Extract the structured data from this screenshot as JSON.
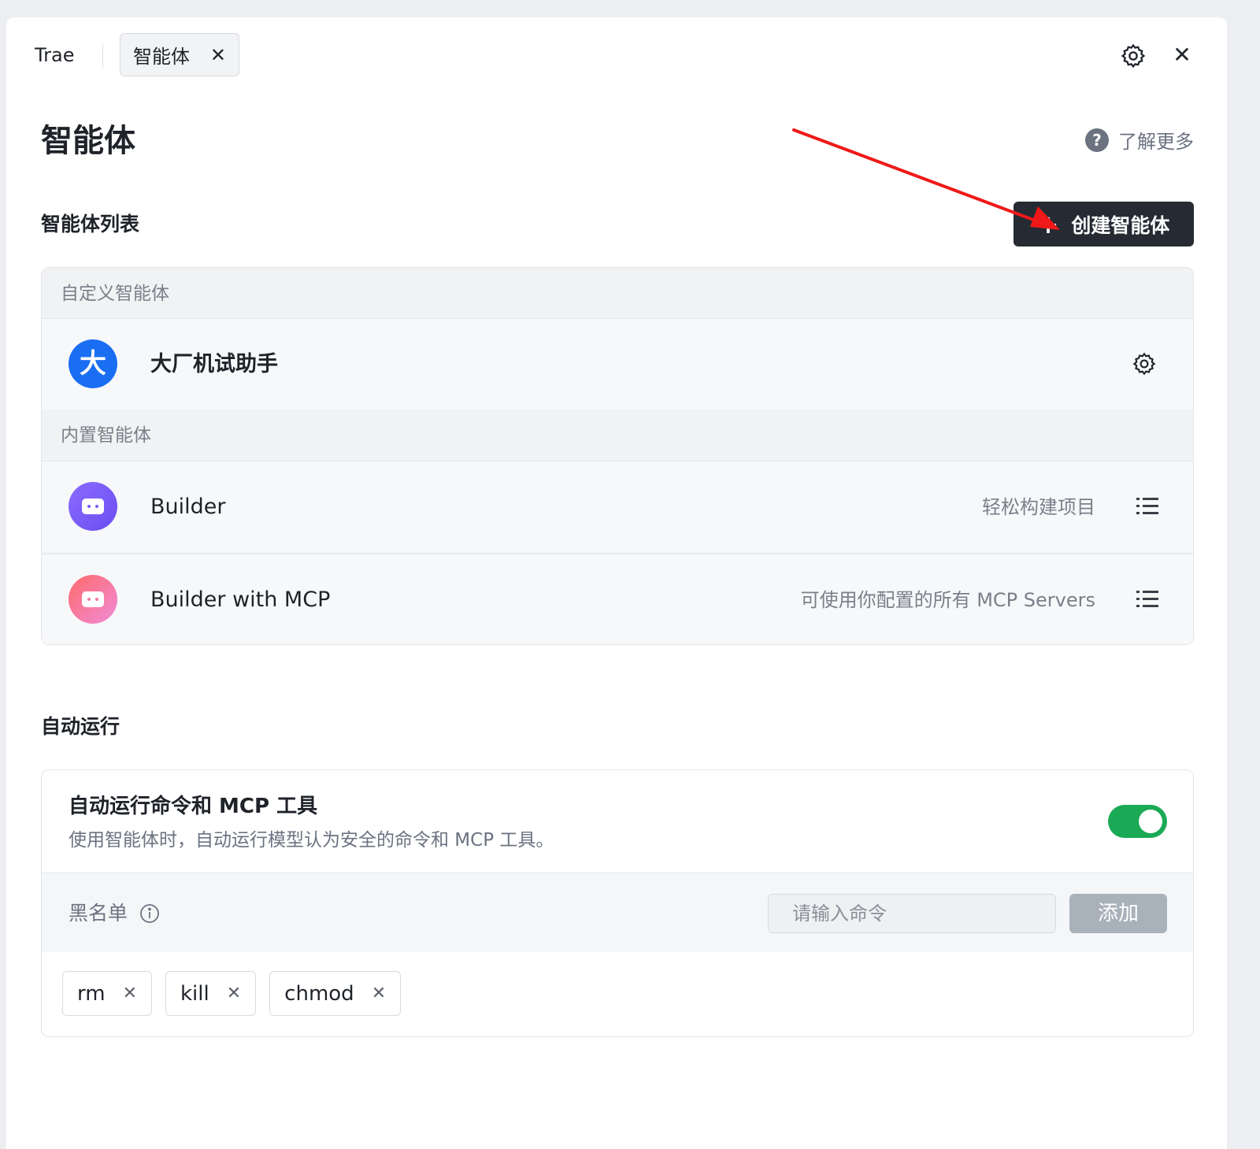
{
  "header": {
    "app_name": "Trae",
    "tab_label": "智能体",
    "tab_close": "✕",
    "close_glyph": "✕"
  },
  "page": {
    "title": "智能体",
    "learn_more": "了解更多",
    "help_glyph": "?"
  },
  "agents": {
    "section_title": "智能体列表",
    "create_button": "创建智能体",
    "create_plus": "+",
    "custom_group_label": "自定义智能体",
    "custom_items": [
      {
        "avatar_text": "大",
        "name": "大厂机试助手",
        "icon": "gear-icon"
      }
    ],
    "builtin_group_label": "内置智能体",
    "builtin_items": [
      {
        "name": "Builder",
        "description": "轻松构建项目",
        "avatar_color": "#7a5cf5",
        "icon": "list-icon"
      },
      {
        "name": "Builder with MCP",
        "description": "可使用你配置的所有 MCP Servers",
        "avatar_color": "#f27aa7",
        "icon": "list-icon"
      }
    ]
  },
  "auto_run": {
    "section_title": "自动运行",
    "title": "自动运行命令和 MCP 工具",
    "description": "使用智能体时，自动运行模型认为安全的命令和 MCP 工具。",
    "enabled": true,
    "toggle_color": "#1aaa55",
    "blacklist_label": "黑名单",
    "input_placeholder": "请输入命令",
    "input_value": "",
    "add_button": "添加",
    "tags": [
      {
        "label": "rm",
        "remove": "✕"
      },
      {
        "label": "kill",
        "remove": "✕"
      },
      {
        "label": "chmod",
        "remove": "✕"
      }
    ]
  },
  "colors": {
    "primary_button": "#252a33",
    "annotation_arrow": "#f01818",
    "avatar_blue": "#1a6ef2"
  }
}
